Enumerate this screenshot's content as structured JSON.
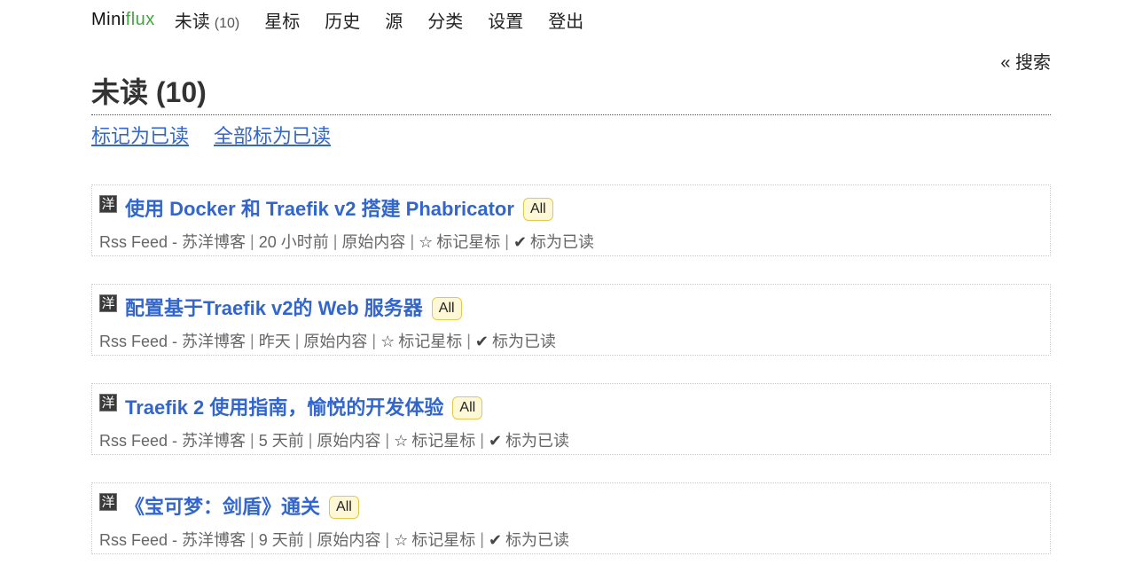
{
  "nav": {
    "logo_prefix": "Mini",
    "logo_suffix": "flux",
    "items": [
      {
        "label": "未读",
        "count": "(10)"
      },
      {
        "label": "星标"
      },
      {
        "label": "历史"
      },
      {
        "label": "源"
      },
      {
        "label": "分类"
      },
      {
        "label": "设置"
      },
      {
        "label": "登出"
      }
    ]
  },
  "search": {
    "label": "« 搜索"
  },
  "page": {
    "title": "未读 (10)",
    "actions": [
      "标记为已读",
      "全部标为已读"
    ]
  },
  "entries": [
    {
      "icon": "洋",
      "title": "使用 Docker 和 Traefik v2 搭建 Phabricator",
      "category": "All",
      "feed": "Rss Feed - 苏洋博客",
      "time": "20 小时前",
      "original": "原始内容",
      "star_icon": "☆",
      "star_label": "标记星标",
      "read_icon": "✔",
      "read_label": "标为已读"
    },
    {
      "icon": "洋",
      "title": "配置基于Traefik v2的 Web 服务器",
      "category": "All",
      "feed": "Rss Feed - 苏洋博客",
      "time": "昨天",
      "original": "原始内容",
      "star_icon": "☆",
      "star_label": "标记星标",
      "read_icon": "✔",
      "read_label": "标为已读"
    },
    {
      "icon": "洋",
      "title": "Traefik 2 使用指南，愉悦的开发体验",
      "category": "All",
      "feed": "Rss Feed - 苏洋博客",
      "time": "5 天前",
      "original": "原始内容",
      "star_icon": "☆",
      "star_label": "标记星标",
      "read_icon": "✔",
      "read_label": "标为已读"
    },
    {
      "icon": "洋",
      "title": "《宝可梦：剑盾》通关",
      "category": "All",
      "feed": "Rss Feed - 苏洋博客",
      "time": "9 天前",
      "original": "原始内容",
      "star_icon": "☆",
      "star_label": "标记星标",
      "read_icon": "✔",
      "read_label": "标为已读"
    }
  ],
  "colors": {
    "link": "#3366cc",
    "logo_accent": "#3fa83f",
    "badge_bg": "#fff8d6",
    "badge_border": "#e3c84e"
  }
}
